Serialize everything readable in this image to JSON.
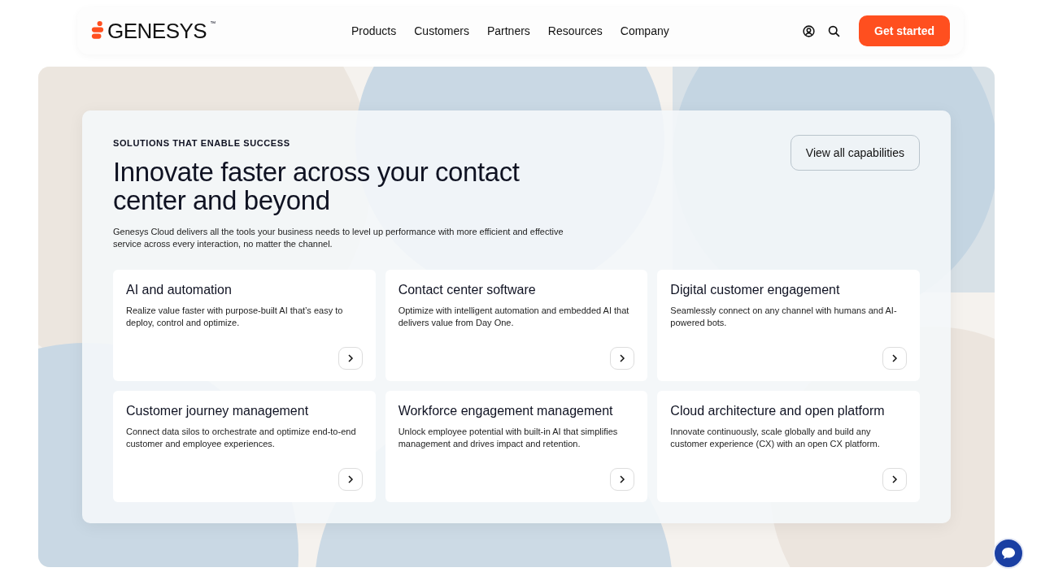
{
  "header": {
    "logo": {
      "text": "GENESYS",
      "mark": "™"
    },
    "nav": [
      "Products",
      "Customers",
      "Partners",
      "Resources",
      "Company"
    ],
    "cta": "Get started"
  },
  "hero": {
    "eyebrow": "SOLUTIONS THAT ENABLE SUCCESS",
    "title": "Innovate faster across your contact center and beyond",
    "description": "Genesys Cloud delivers all the tools your business needs to level up performance with more efficient and effective service across every interaction, no matter the channel.",
    "button": "View all capabilities",
    "cards": [
      {
        "title": "AI and automation",
        "text": "Realize value faster with purpose-built AI that’s easy to deploy, control and optimize."
      },
      {
        "title": "Contact center software",
        "text": "Optimize with intelligent automation and embedded AI that delivers value from Day One."
      },
      {
        "title": "Digital customer engagement",
        "text": "Seamlessly connect on any channel with humans and AI-powered bots."
      },
      {
        "title": "Customer journey management",
        "text": "Connect data silos to orchestrate and optimize end-to-end customer and employee experiences."
      },
      {
        "title": "Workforce engagement management",
        "text": "Unlock employee potential with built-in AI that simplifies management and drives impact and retention."
      },
      {
        "title": "Cloud architecture and open platform",
        "text": "Innovate continuously, scale globally and build any customer experience (CX) with an open CX platform."
      }
    ]
  }
}
